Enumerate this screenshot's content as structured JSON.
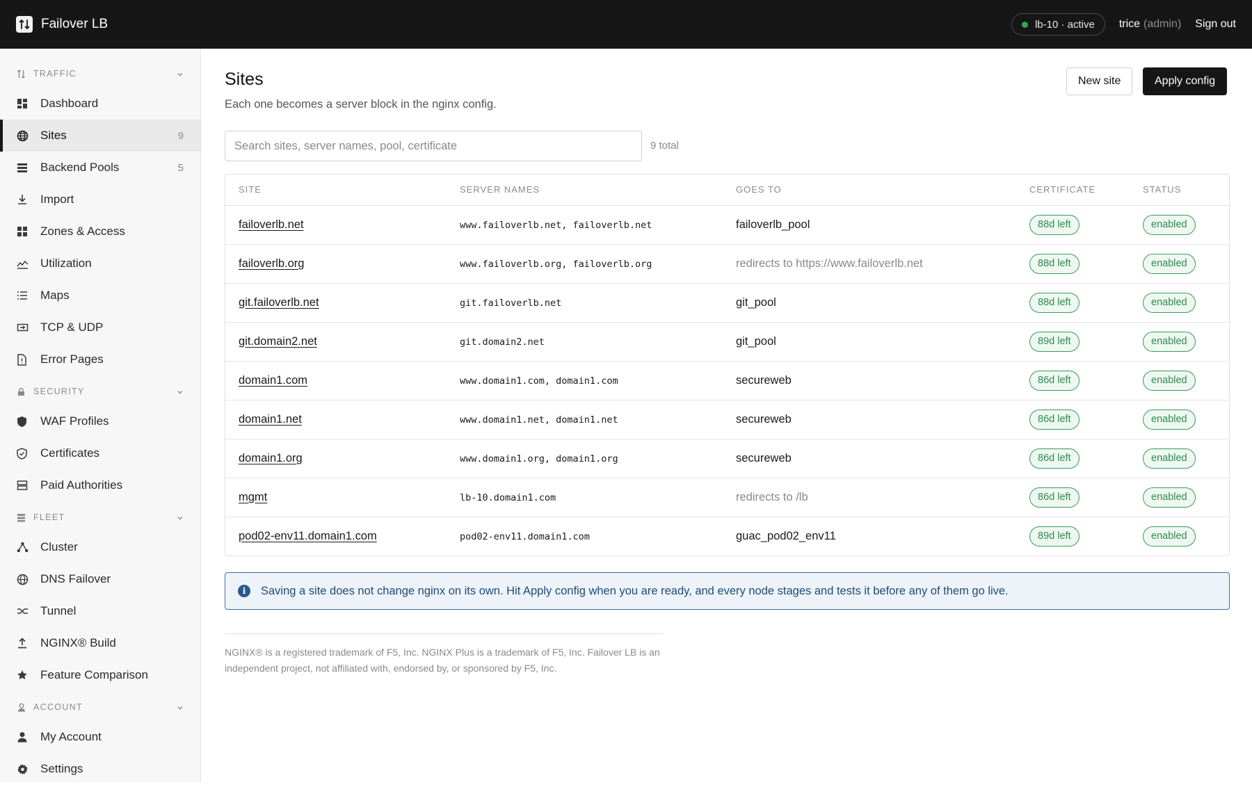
{
  "app": {
    "name": "Failover LB"
  },
  "header": {
    "node_status": "lb-10 · active",
    "user": "trice",
    "role": "(admin)",
    "sign_out": "Sign out"
  },
  "sidebar": {
    "sections": [
      {
        "title": "TRAFFIC",
        "icon": "traffic-icon",
        "items": [
          {
            "label": "Dashboard",
            "icon": "dashboard-icon",
            "count": ""
          },
          {
            "label": "Sites",
            "icon": "globe-icon",
            "count": "9",
            "active": true
          },
          {
            "label": "Backend Pools",
            "icon": "stack-icon",
            "count": "5"
          },
          {
            "label": "Import",
            "icon": "download-icon",
            "count": ""
          },
          {
            "label": "Zones & Access",
            "icon": "grid-icon",
            "count": ""
          },
          {
            "label": "Utilization",
            "icon": "chart-icon",
            "count": ""
          },
          {
            "label": "Maps",
            "icon": "list-icon",
            "count": ""
          },
          {
            "label": "TCP & UDP",
            "icon": "port-icon",
            "count": ""
          },
          {
            "label": "Error Pages",
            "icon": "file-icon",
            "count": ""
          }
        ]
      },
      {
        "title": "SECURITY",
        "icon": "lock-icon",
        "items": [
          {
            "label": "WAF Profiles",
            "icon": "shield-icon",
            "count": ""
          },
          {
            "label": "Certificates",
            "icon": "shield-check-icon",
            "count": ""
          },
          {
            "label": "Paid Authorities",
            "icon": "server-icon",
            "count": ""
          }
        ]
      },
      {
        "title": "FLEET",
        "icon": "fleet-icon",
        "items": [
          {
            "label": "Cluster",
            "icon": "cluster-icon",
            "count": ""
          },
          {
            "label": "DNS Failover",
            "icon": "dns-globe-icon",
            "count": ""
          },
          {
            "label": "Tunnel",
            "icon": "tunnel-icon",
            "count": ""
          },
          {
            "label": "NGINX® Build",
            "icon": "upload-icon",
            "count": ""
          },
          {
            "label": "Feature Comparison",
            "icon": "star-icon",
            "count": ""
          }
        ]
      },
      {
        "title": "ACCOUNT",
        "icon": "user-icon",
        "items": [
          {
            "label": "My Account",
            "icon": "person-icon",
            "count": ""
          },
          {
            "label": "Settings",
            "icon": "gear-icon",
            "count": ""
          }
        ]
      }
    ]
  },
  "page": {
    "title": "Sites",
    "subtitle": "Each one becomes a server block in the nginx config.",
    "new_site_label": "New site",
    "apply_label": "Apply config"
  },
  "search": {
    "placeholder": "Search sites, server names, pool, certificate",
    "value": "",
    "total": "9 total"
  },
  "table": {
    "columns": [
      "SITE",
      "SERVER NAMES",
      "GOES TO",
      "CERTIFICATE",
      "STATUS"
    ],
    "rows": [
      {
        "site": "failoverlb.net",
        "server_names": "www.failoverlb.net, failoverlb.net",
        "goes_to": "failoverlb_pool",
        "redirect": false,
        "cert": "88d left",
        "status": "enabled"
      },
      {
        "site": "failoverlb.org",
        "server_names": "www.failoverlb.org, failoverlb.org",
        "goes_to": "redirects to https://www.failoverlb.net",
        "redirect": true,
        "cert": "88d left",
        "status": "enabled"
      },
      {
        "site": "git.failoverlb.net",
        "server_names": "git.failoverlb.net",
        "goes_to": "git_pool",
        "redirect": false,
        "cert": "88d left",
        "status": "enabled"
      },
      {
        "site": "git.domain2.net",
        "server_names": "git.domain2.net",
        "goes_to": "git_pool",
        "redirect": false,
        "cert": "89d left",
        "status": "enabled"
      },
      {
        "site": "domain1.com",
        "server_names": "www.domain1.com, domain1.com",
        "goes_to": "secureweb",
        "redirect": false,
        "cert": "86d left",
        "status": "enabled"
      },
      {
        "site": "domain1.net",
        "server_names": "www.domain1.net, domain1.net",
        "goes_to": "secureweb",
        "redirect": false,
        "cert": "86d left",
        "status": "enabled"
      },
      {
        "site": "domain1.org",
        "server_names": "www.domain1.org, domain1.org",
        "goes_to": "secureweb",
        "redirect": false,
        "cert": "86d left",
        "status": "enabled"
      },
      {
        "site": "mgmt",
        "server_names": "lb-10.domain1.com",
        "goes_to": "redirects to /lb",
        "redirect": true,
        "cert": "86d left",
        "status": "enabled"
      },
      {
        "site": "pod02-env11.domain1.com",
        "server_names": "pod02-env11.domain1.com",
        "goes_to": "guac_pod02_env11",
        "redirect": false,
        "cert": "89d left",
        "status": "enabled"
      }
    ]
  },
  "info": {
    "text": "Saving a site does not change nginx on its own. Hit Apply config when you are ready, and every node stages and tests it before any of them go live."
  },
  "footer": {
    "note": "NGINX® is a registered trademark of F5, Inc. NGINX Plus is a trademark of F5, Inc. Failover LB is an independent project, not affiliated with, endorsed by, or sponsored by F5, Inc."
  },
  "colors": {
    "topbar": "#161616",
    "accent_green": "#2e8a50",
    "info_blue": "#1f4a78"
  }
}
